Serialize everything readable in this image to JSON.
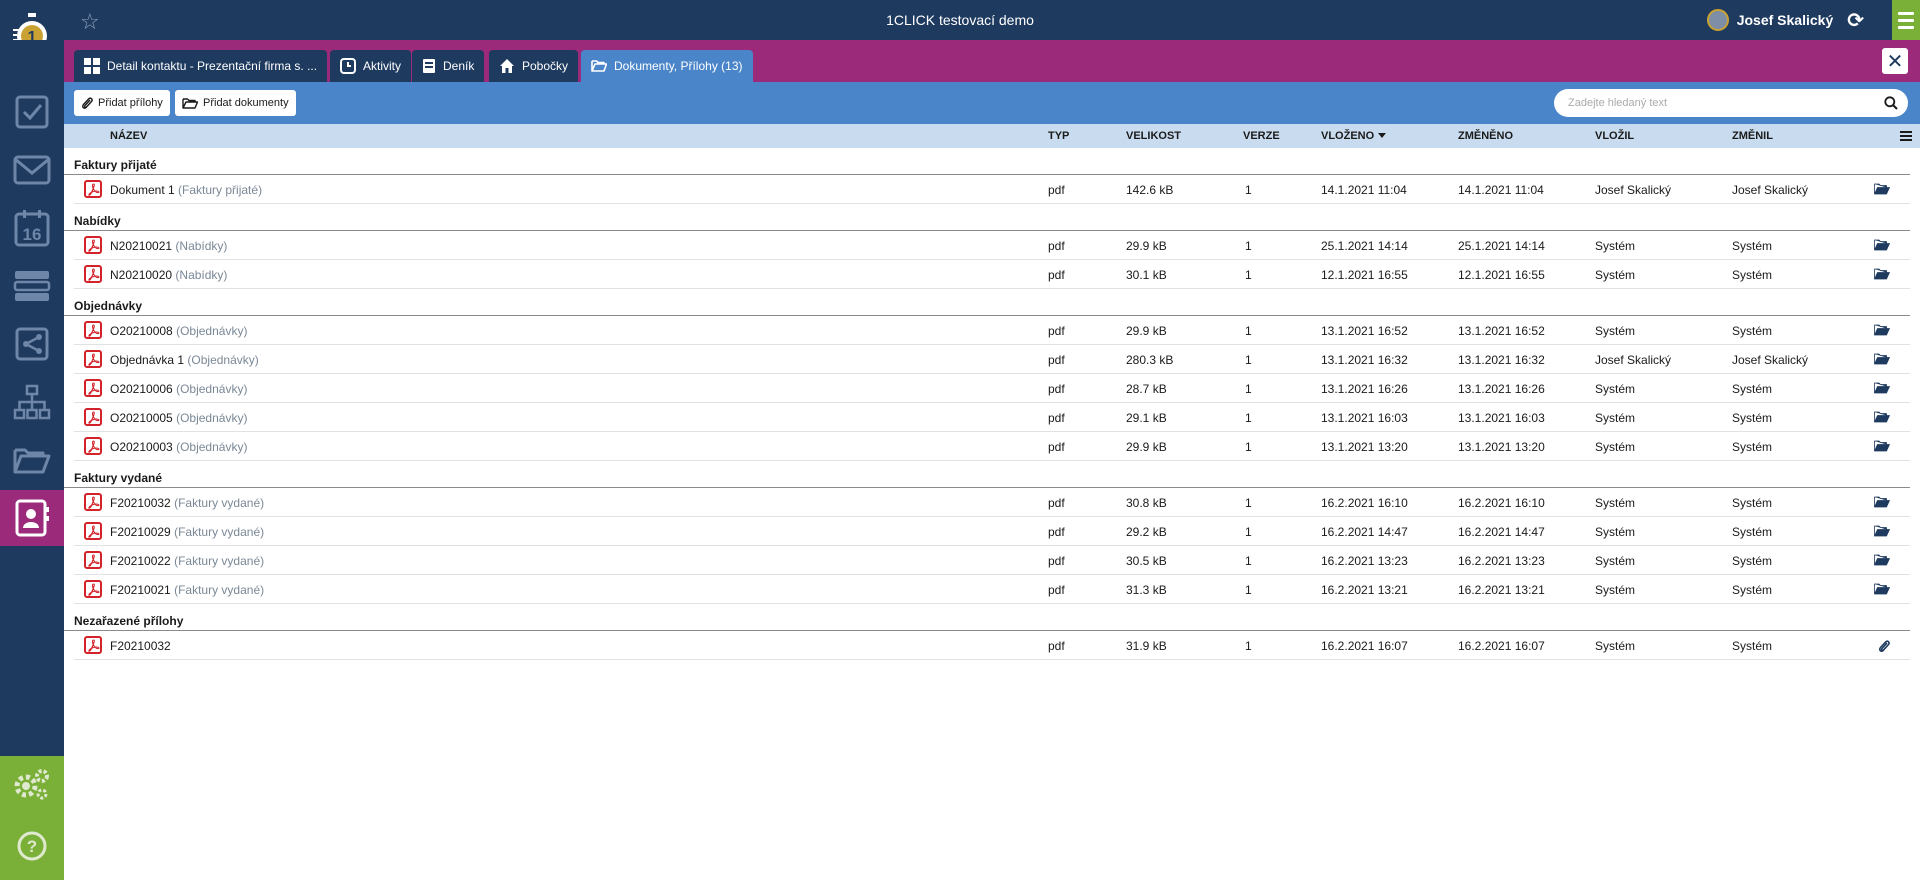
{
  "app": {
    "title": "1CLICK testovací demo"
  },
  "user": {
    "name": "Josef Skalický"
  },
  "tabs": [
    {
      "label": "Detail kontaktu - Prezentační firma s. ...",
      "icon": "grid-icon"
    },
    {
      "label": "Aktivity",
      "icon": "clock-icon"
    },
    {
      "label": "Deník",
      "icon": "notebook-icon"
    },
    {
      "label": "Pobočky",
      "icon": "home-icon"
    },
    {
      "label": "Dokumenty, Přílohy (13)",
      "icon": "folder-open-icon",
      "active": true
    }
  ],
  "toolbar": {
    "add_attachments": "Přidat přílohy",
    "add_documents": "Přidat dokumenty",
    "search_placeholder": "Zadejte hledaný text"
  },
  "columns": {
    "name": "NÁZEV",
    "type": "TYP",
    "size": "VELIKOST",
    "version": "VERZE",
    "inserted": "VLOŽENO",
    "changed": "ZMĚNĚNO",
    "inserted_by": "VLOŽIL",
    "changed_by": "ZMĚNIL"
  },
  "groups": [
    {
      "label": "Faktury přijaté",
      "rows": [
        {
          "name": "Dokument 1",
          "cat": "(Faktury přijaté)",
          "type": "pdf",
          "size": "142.6 kB",
          "version": "1",
          "inserted": "14.1.2021 11:04",
          "changed": "14.1.2021 11:04",
          "by": "Josef Skalický",
          "chby": "Josef Skalický",
          "icon": "folder-icon"
        }
      ]
    },
    {
      "label": "Nabídky",
      "rows": [
        {
          "name": "N20210021",
          "cat": "(Nabídky)",
          "type": "pdf",
          "size": "29.9 kB",
          "version": "1",
          "inserted": "25.1.2021 14:14",
          "changed": "25.1.2021 14:14",
          "by": "Systém",
          "chby": "Systém",
          "icon": "folder-icon"
        },
        {
          "name": "N20210020",
          "cat": "(Nabídky)",
          "type": "pdf",
          "size": "30.1 kB",
          "version": "1",
          "inserted": "12.1.2021 16:55",
          "changed": "12.1.2021 16:55",
          "by": "Systém",
          "chby": "Systém",
          "icon": "folder-icon"
        }
      ]
    },
    {
      "label": "Objednávky",
      "rows": [
        {
          "name": "O20210008",
          "cat": "(Objednávky)",
          "type": "pdf",
          "size": "29.9 kB",
          "version": "1",
          "inserted": "13.1.2021 16:52",
          "changed": "13.1.2021 16:52",
          "by": "Systém",
          "chby": "Systém",
          "icon": "folder-icon"
        },
        {
          "name": "Objednávka 1",
          "cat": "(Objednávky)",
          "type": "pdf",
          "size": "280.3 kB",
          "version": "1",
          "inserted": "13.1.2021 16:32",
          "changed": "13.1.2021 16:32",
          "by": "Josef Skalický",
          "chby": "Josef Skalický",
          "icon": "folder-icon"
        },
        {
          "name": "O20210006",
          "cat": "(Objednávky)",
          "type": "pdf",
          "size": "28.7 kB",
          "version": "1",
          "inserted": "13.1.2021 16:26",
          "changed": "13.1.2021 16:26",
          "by": "Systém",
          "chby": "Systém",
          "icon": "folder-icon"
        },
        {
          "name": "O20210005",
          "cat": "(Objednávky)",
          "type": "pdf",
          "size": "29.1 kB",
          "version": "1",
          "inserted": "13.1.2021 16:03",
          "changed": "13.1.2021 16:03",
          "by": "Systém",
          "chby": "Systém",
          "icon": "folder-icon"
        },
        {
          "name": "O20210003",
          "cat": "(Objednávky)",
          "type": "pdf",
          "size": "29.9 kB",
          "version": "1",
          "inserted": "13.1.2021 13:20",
          "changed": "13.1.2021 13:20",
          "by": "Systém",
          "chby": "Systém",
          "icon": "folder-icon"
        }
      ]
    },
    {
      "label": "Faktury vydané",
      "rows": [
        {
          "name": "F20210032",
          "cat": "(Faktury vydané)",
          "type": "pdf",
          "size": "30.8 kB",
          "version": "1",
          "inserted": "16.2.2021 16:10",
          "changed": "16.2.2021 16:10",
          "by": "Systém",
          "chby": "Systém",
          "icon": "folder-icon"
        },
        {
          "name": "F20210029",
          "cat": "(Faktury vydané)",
          "type": "pdf",
          "size": "29.2 kB",
          "version": "1",
          "inserted": "16.2.2021 14:47",
          "changed": "16.2.2021 14:47",
          "by": "Systém",
          "chby": "Systém",
          "icon": "folder-icon"
        },
        {
          "name": "F20210022",
          "cat": "(Faktury vydané)",
          "type": "pdf",
          "size": "30.5 kB",
          "version": "1",
          "inserted": "16.2.2021 13:23",
          "changed": "16.2.2021 13:23",
          "by": "Systém",
          "chby": "Systém",
          "icon": "folder-icon"
        },
        {
          "name": "F20210021",
          "cat": "(Faktury vydané)",
          "type": "pdf",
          "size": "31.3 kB",
          "version": "1",
          "inserted": "16.2.2021 13:21",
          "changed": "16.2.2021 13:21",
          "by": "Systém",
          "chby": "Systém",
          "icon": "folder-icon"
        }
      ]
    },
    {
      "label": "Nezařazené přílohy",
      "rows": [
        {
          "name": "F20210032",
          "cat": "",
          "type": "pdf",
          "size": "31.9 kB",
          "version": "1",
          "inserted": "16.2.2021 16:07",
          "changed": "16.2.2021 16:07",
          "by": "Systém",
          "chby": "Systém",
          "icon": "paperclip-icon"
        }
      ]
    }
  ],
  "colors": {
    "navy": "#1e3a5f",
    "magenta": "#9b2a7b",
    "blue": "#4a85c9",
    "green": "#7ab037",
    "header": "#c9dcef",
    "pdf_red": "#d2232a"
  },
  "sidebar_icons": [
    "checkbox-icon",
    "mail-icon",
    "calendar-icon",
    "list-icon",
    "flow-icon",
    "org-chart-icon",
    "folder-icon",
    "contact-card-icon",
    "gears-icon",
    "help-icon"
  ],
  "calendar_day": "16",
  "logo_digit": "1"
}
